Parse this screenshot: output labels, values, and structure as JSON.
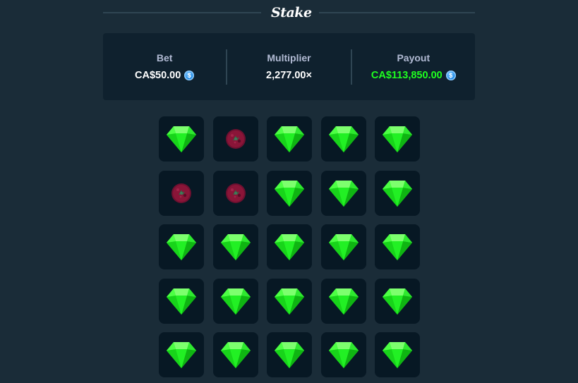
{
  "header": {
    "logo_text": "Stake"
  },
  "summary": {
    "bet": {
      "label": "Bet",
      "value": "CA$50.00",
      "currency_icon": "coin-icon"
    },
    "multiplier": {
      "label": "Multiplier",
      "value": "2,277.00×"
    },
    "payout": {
      "label": "Payout",
      "value": "CA$113,850.00",
      "currency_icon": "coin-icon"
    }
  },
  "colors": {
    "background": "#1a2c38",
    "panel": "#0f212e",
    "tile": "#071824",
    "gem": "#1fff20",
    "mine": "#8a1538",
    "payout_text": "#1fff20"
  },
  "board": {
    "rows": [
      [
        "gem",
        "mine",
        "gem",
        "gem",
        "gem"
      ],
      [
        "mine",
        "mine",
        "gem",
        "gem",
        "gem"
      ],
      [
        "gem",
        "gem",
        "gem",
        "gem",
        "gem"
      ],
      [
        "gem",
        "gem",
        "gem",
        "gem",
        "gem"
      ],
      [
        "gem",
        "gem",
        "gem",
        "gem",
        "gem"
      ]
    ]
  }
}
